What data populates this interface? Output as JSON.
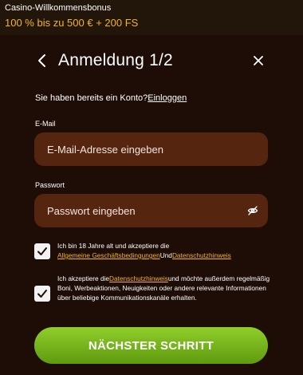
{
  "banner": {
    "title": "Casino-Willkommensbonus",
    "offer": "100 % bis zu 500 € + 200 FS"
  },
  "modal": {
    "title": "Anmeldung 1/2",
    "account_question": "Sie haben bereits ein Konto?",
    "login_link": "Einloggen",
    "email": {
      "label": "E-Mail",
      "placeholder": "E-Mail-Adresse eingeben",
      "value": ""
    },
    "password": {
      "label": "Passwort",
      "placeholder": "Passwort eingeben",
      "value": "",
      "toggle_icon": "eye-off-icon"
    },
    "consent_terms": {
      "checked": true,
      "text_before": "Ich bin 18 Jahre alt und akzeptiere die ",
      "link_terms": "Allgemeine Geschäftsbedingungen",
      "text_and": "Und",
      "link_privacy": "Datenschutzhinweis"
    },
    "consent_marketing": {
      "checked": true,
      "text_before": "Ich akzeptiere die",
      "link_privacy": "Datenschutzhinweis",
      "text_after": "und möchte außerdem regelmäßig Boni, Werbeaktionen, Neuigkeiten oder andere relevante Informationen über beliebige Kommunikationskanäle erhalten."
    },
    "next_button": "NÄCHSTER SCHRITT"
  },
  "colors": {
    "background": "#1d0d06",
    "input_background": "#552510",
    "accent_gold": "#f4b322",
    "button_green": "#7cb81f"
  }
}
